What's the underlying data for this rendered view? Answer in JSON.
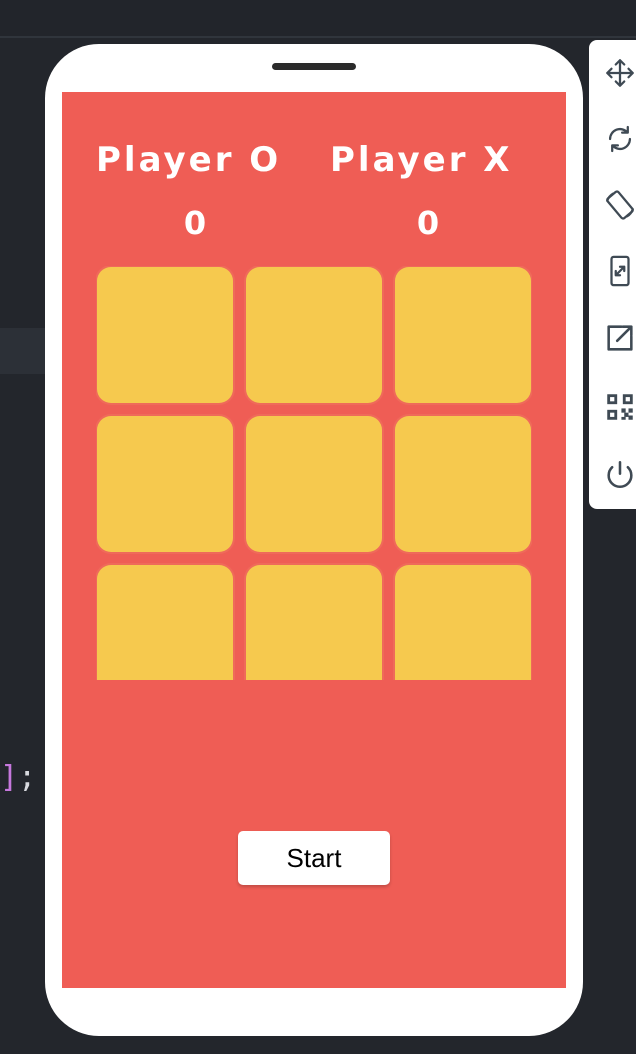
{
  "game": {
    "player_o_label": "Player O",
    "player_x_label": "Player X",
    "score_o": "0",
    "score_x": "0",
    "start_label": "Start",
    "cells": [
      "",
      "",
      "",
      "",
      "",
      "",
      "",
      "",
      ""
    ]
  },
  "editor": {
    "code_fragment_bracket": "]",
    "code_fragment_rest": ";"
  },
  "tools": [
    {
      "icon": "move-icon"
    },
    {
      "icon": "rotate-icon"
    },
    {
      "icon": "rotate-device-icon"
    },
    {
      "icon": "resize-icon"
    },
    {
      "icon": "open-external-icon"
    },
    {
      "icon": "qr-code-icon"
    },
    {
      "icon": "power-icon"
    }
  ],
  "colors": {
    "screen_bg": "#ef5d55",
    "cell": "#f6c94e",
    "editor_bg": "#23262c",
    "icon": "#3f4a54"
  }
}
